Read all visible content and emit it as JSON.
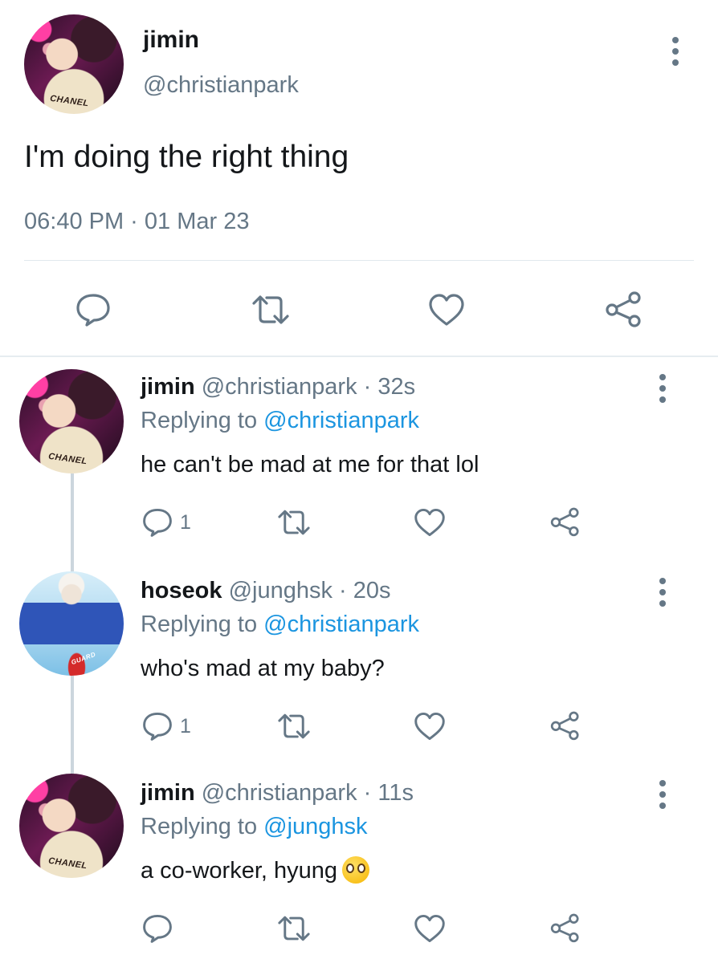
{
  "main_tweet": {
    "name": "jimin",
    "handle": "@christianpark",
    "text": "I'm doing the right thing",
    "timestamp": "06:40 PM · 01 Mar 23",
    "avatar_label": "CHANEL"
  },
  "replies": [
    {
      "name": "jimin",
      "meta": "@christianpark · 32s",
      "replying_prefix": "Replying to ",
      "replying_to": "@christianpark",
      "text": "he can't be mad at me for that lol",
      "reply_count": "1",
      "avatar_label": "CHANEL"
    },
    {
      "name": "hoseok",
      "meta": "@junghsk · 20s",
      "replying_prefix": "Replying to ",
      "replying_to": "@christianpark",
      "text": "who's mad at my baby?",
      "reply_count": "1",
      "avatar_label": "GUARD"
    },
    {
      "name": "jimin",
      "meta": "@christianpark · 11s",
      "replying_prefix": "Replying to ",
      "replying_to": "@junghsk",
      "text": "a co-worker, hyung",
      "reply_count": "",
      "avatar_label": "CHANEL"
    }
  ],
  "icons": {
    "reply": "reply-icon",
    "retweet": "retweet-icon",
    "like": "heart-icon",
    "share": "share-icon",
    "more": "more-vertical-icon",
    "emoji": "pleading-face-emoji"
  },
  "colors": {
    "link": "#1b95e0",
    "muted": "#657786",
    "text": "#14171a",
    "divider": "#e1e8ed",
    "thread_line": "#ccd6dd"
  }
}
